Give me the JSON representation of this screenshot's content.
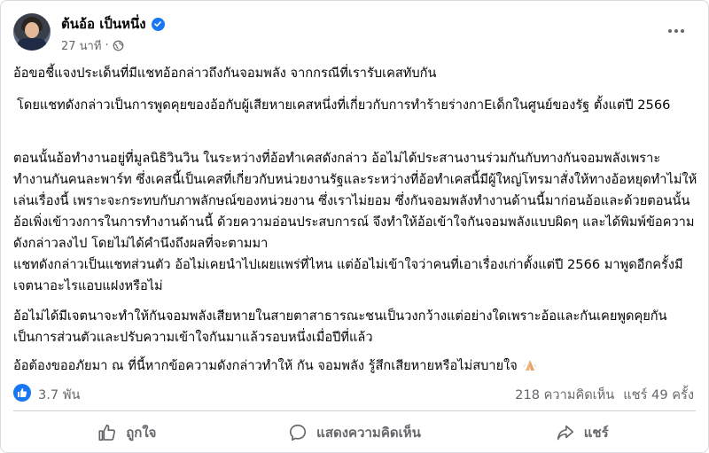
{
  "post": {
    "author": "ต้นอ้อ เป็นหนึ่ง",
    "time": "27 นาที",
    "separator": "·",
    "paragraphs": [
      "อ้อขอชี้แจงประเด็นที่มีแชทอ้อกล่าวถึงกันจอมพลัง จากกรณีที่เรารับเคสทับกัน",
      "โดยแชทดังกล่าวเป็นการพูดคุยของอ้อกับผู้เสียหายเคสหนึ่งที่เกี่ยวกับการทำร้ายร่างกาEเด็กในศูนย์ของรัฐ ตั้งแต่ปี 2566",
      "ตอนนั้นอ้อทำงานอยู่ที่มูลนิธิวินวิน ในระหว่างที่อ้อทำเคสดังกล่าว อ้อไม่ได้ประสานงานร่วมกันกับทางกันจอมพลังเพราะทำงานกันคนละพาร์ท ซึ่งเคสนี้เป็นเคสที่เกี่ยวกับหน่วยงานรัฐและระหว่างที่อ้อทำเคสนี้มีผู้ใหญ่โทรมาสั่งให้ทางอ้อหยุดทำไม่ให้เล่นเรื่องนี้ เพราะจะกระทบกับภาพลักษณ์ของหน่วยงาน ซึ่งเราไม่ยอม ซึ่งกันจอมพลังทำงานด้านนี้มาก่อนอ้อและด้วยตอนนั้นอ้อเพิ่งเข้าวงการในการทำงานด้านนี้ ด้วยความอ่อนประสบการณ์ จึงทำให้อ้อเข้าใจกันจอมพลังแบบผิดๆ และได้พิมพ์ข้อความดังกล่าวลงไป โดยไม่ได้คำนึงถึงผลที่จะตามมา",
      "แชทดังกล่าวเป็นแชทส่วนตัว อ้อไม่เคยนำไปเผยแพร่ที่ไหน แต่อ้อไม่เข้าใจว่าคนที่เอาเรื่องเก่าตั้งแต่ปี 2566 มาพูดอีกครั้งมีเจตนาอะไรแอบแฝงหรือไม่",
      "อ้อไม่ได้มีเจตนาจะทำให้กันจอมพลังเสียหายในสายตาสาธารณะชนเป็นวงกว้างแต่อย่างใดเพราะอ้อและกันเคยพูดคุยกันเป็นการส่วนตัวและปรับความเข้าใจกันมาแล้วรอบหนึ่งเมื่อปีที่แล้ว",
      "อ้อต้องขออภัยมา ณ ที่นี้หากข้อความดังกล่าวทำให้ กัน จอมพลัง รู้สึกเสียหายหรือไม่สบายใจ"
    ],
    "reactions_count": "3.7 พัน",
    "comments_count": "218 ความคิดเห็น",
    "shares_count": "แชร์ 49 ครั้ง",
    "actions": {
      "like": "ถูกใจ",
      "comment": "แสดงความคิดเห็น",
      "share": "แชร์"
    }
  },
  "icons": {
    "verified": "verified-badge-icon",
    "privacy": "globe-icon",
    "more": "more-options-icon",
    "reaction": "thumbs-up-icon",
    "emoji": "folded-hands-icon"
  },
  "colors": {
    "brand_blue": "#1877f2",
    "secondary_text": "#65676b",
    "primary_text": "#050505",
    "divider": "#ced0d4"
  }
}
